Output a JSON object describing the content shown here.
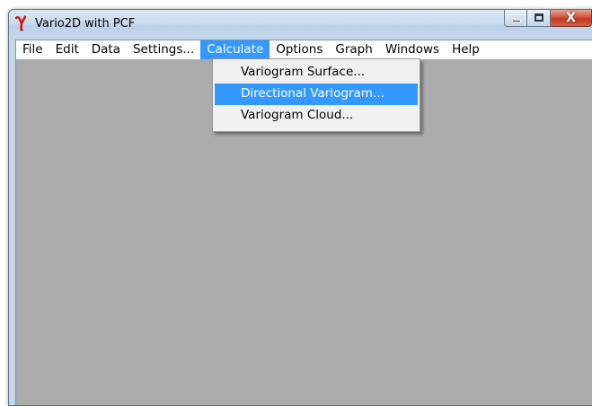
{
  "window": {
    "title": "Vario2D with PCF",
    "icon": "gamma-icon",
    "close_glyph": "X"
  },
  "menubar": {
    "items": [
      {
        "label": "File"
      },
      {
        "label": "Edit"
      },
      {
        "label": "Data"
      },
      {
        "label": "Settings..."
      },
      {
        "label": "Calculate"
      },
      {
        "label": "Options"
      },
      {
        "label": "Graph"
      },
      {
        "label": "Windows"
      },
      {
        "label": "Help"
      }
    ],
    "active_item": "Calculate"
  },
  "calculate_menu": {
    "items": [
      {
        "label": "Variogram Surface..."
      },
      {
        "label": "Directional Variogram..."
      },
      {
        "label": "Variogram Cloud..."
      }
    ],
    "highlighted_item": "Directional Variogram..."
  },
  "colors": {
    "selection": "#3399ff",
    "client_background": "#ababab",
    "icon_red": "#cc1111"
  }
}
